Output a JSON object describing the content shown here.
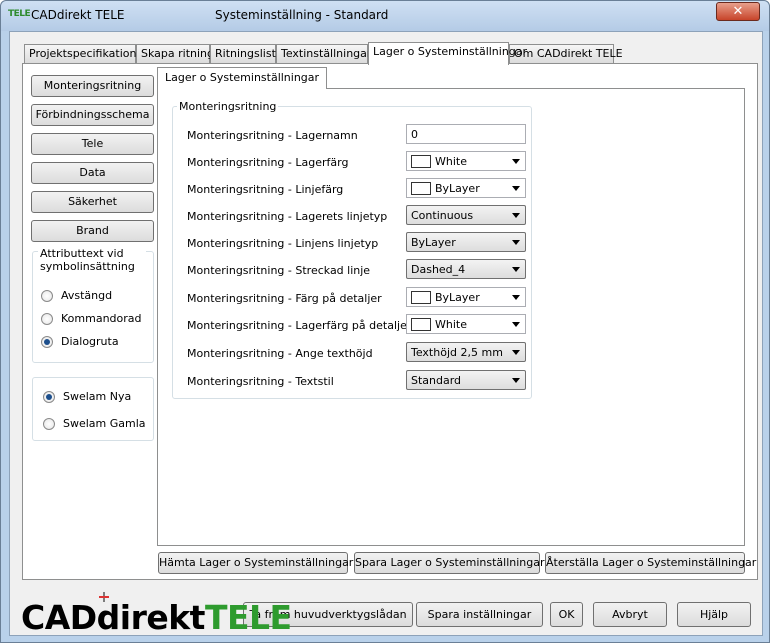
{
  "window": {
    "app_icon_text": "TELE",
    "app_name": "CADdirekt TELE",
    "title": "Systeminställning - Standard",
    "close_glyph": "✕"
  },
  "tabs": [
    {
      "label": "Projektspecifikationer"
    },
    {
      "label": "Skapa ritning"
    },
    {
      "label": "Ritningslista"
    },
    {
      "label": "Textinställningar"
    },
    {
      "label": "Lager o Systeminställningar"
    },
    {
      "label": "Om CADdirekt TELE"
    }
  ],
  "active_tab": "Lager o Systeminställningar",
  "sidebar": {
    "buttons": [
      {
        "label": "Monteringsritning"
      },
      {
        "label": "Förbindningsschema"
      },
      {
        "label": "Tele"
      },
      {
        "label": "Data"
      },
      {
        "label": "Säkerhet"
      },
      {
        "label": "Brand"
      }
    ],
    "attr_group": {
      "title": "Attributtext vid symbolinsättning",
      "options": [
        {
          "label": "Avstängd",
          "selected": false
        },
        {
          "label": "Kommandorad",
          "selected": false
        },
        {
          "label": "Dialogruta",
          "selected": true
        }
      ]
    },
    "swelam_group": {
      "options": [
        {
          "label": "Swelam Nya",
          "selected": true
        },
        {
          "label": "Swelam Gamla",
          "selected": false
        }
      ]
    }
  },
  "inner_tab": {
    "label": "Lager o Systeminställningar"
  },
  "settings_group": {
    "title": "Monteringsritning",
    "rows": [
      {
        "label": "Monteringsritning - Lagernamn",
        "value": "0",
        "kind": "text"
      },
      {
        "label": "Monteringsritning - Lagerfärg",
        "value": "White",
        "kind": "color",
        "swatch": "#ffffff"
      },
      {
        "label": "Monteringsritning - Linjefärg",
        "value": "ByLayer",
        "kind": "color",
        "swatch": "#ffffff"
      },
      {
        "label": "Monteringsritning - Lagerets linjetyp",
        "value": "Continuous",
        "kind": "select"
      },
      {
        "label": "Monteringsritning - Linjens linjetyp",
        "value": "ByLayer",
        "kind": "select"
      },
      {
        "label": "Monteringsritning - Streckad linje",
        "value": "Dashed_4",
        "kind": "select"
      },
      {
        "label": "Monteringsritning - Färg på detaljer",
        "value": "ByLayer",
        "kind": "color",
        "swatch": "#ffffff"
      },
      {
        "label": "Monteringsritning - Lagerfärg på detaljer",
        "value": "White",
        "kind": "color",
        "swatch": "#ffffff"
      },
      {
        "label": "Monteringsritning - Ange texthöjd",
        "value": "Texthöjd 2,5 mm",
        "kind": "select"
      },
      {
        "label": "Monteringsritning - Textstil",
        "value": "Standard",
        "kind": "select"
      }
    ]
  },
  "panel_buttons": {
    "fetch": "Hämta Lager o Systeminställningar",
    "save": "Spara Lager o Systeminställningar",
    "restore": "Återställa Lager o Systeminställningar"
  },
  "footer": {
    "logo_cad": "CADdirekt",
    "logo_tele": "TELE",
    "toolbox": "Ta fram huvudverktygslådan",
    "save_settings": "Spara inställningar",
    "ok": "OK",
    "cancel": "Avbryt",
    "help": "Hjälp"
  },
  "colors": {
    "brand_green": "#2e9b2e",
    "radio_dot": "#1d4f8c"
  }
}
